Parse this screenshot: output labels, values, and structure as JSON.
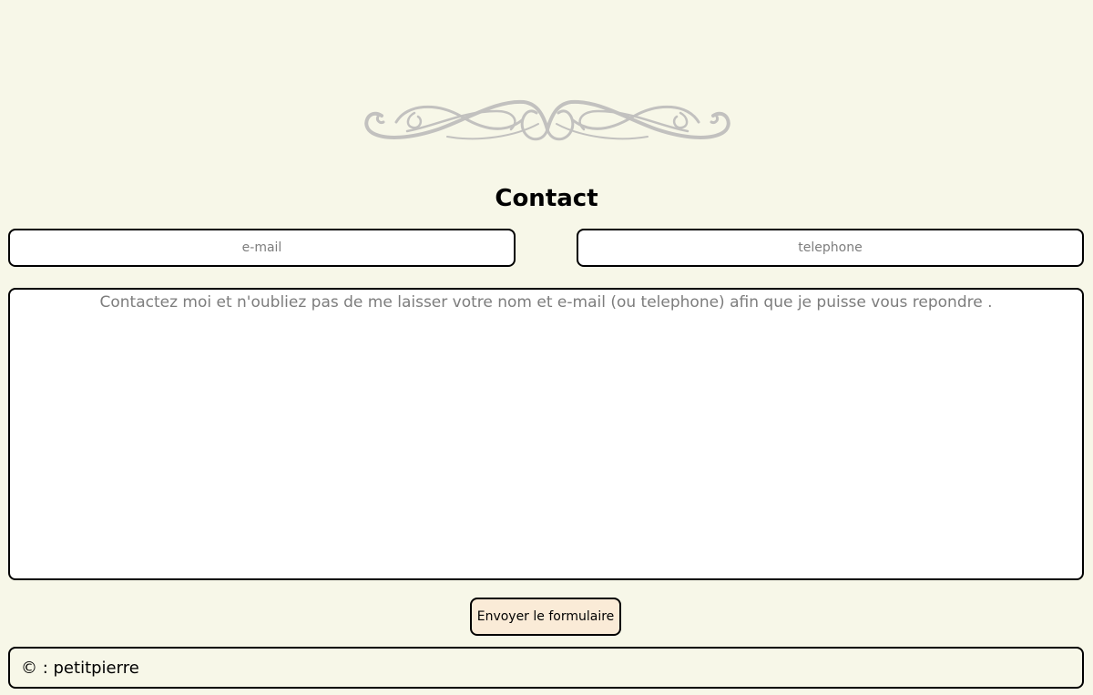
{
  "decoration": {
    "ornament_icon": "ornamental-flourish-divider",
    "ornament_color": "#c2c1bf"
  },
  "contact": {
    "title": "Contact",
    "email_placeholder": "e-mail",
    "phone_placeholder": "telephone",
    "message_placeholder": "Contactez moi et n'oubliez pas de me laisser votre nom et e-mail (ou telephone) afin que je puisse vous repondre .",
    "submit_label": "Envoyer le formulaire"
  },
  "footer": {
    "copyright": "© : petitpierre"
  },
  "colors": {
    "page_background": "#f7f7e8",
    "field_background": "#ffffff",
    "button_background": "#faebd7",
    "border": "#000000",
    "placeholder": "#7d7d7d"
  }
}
